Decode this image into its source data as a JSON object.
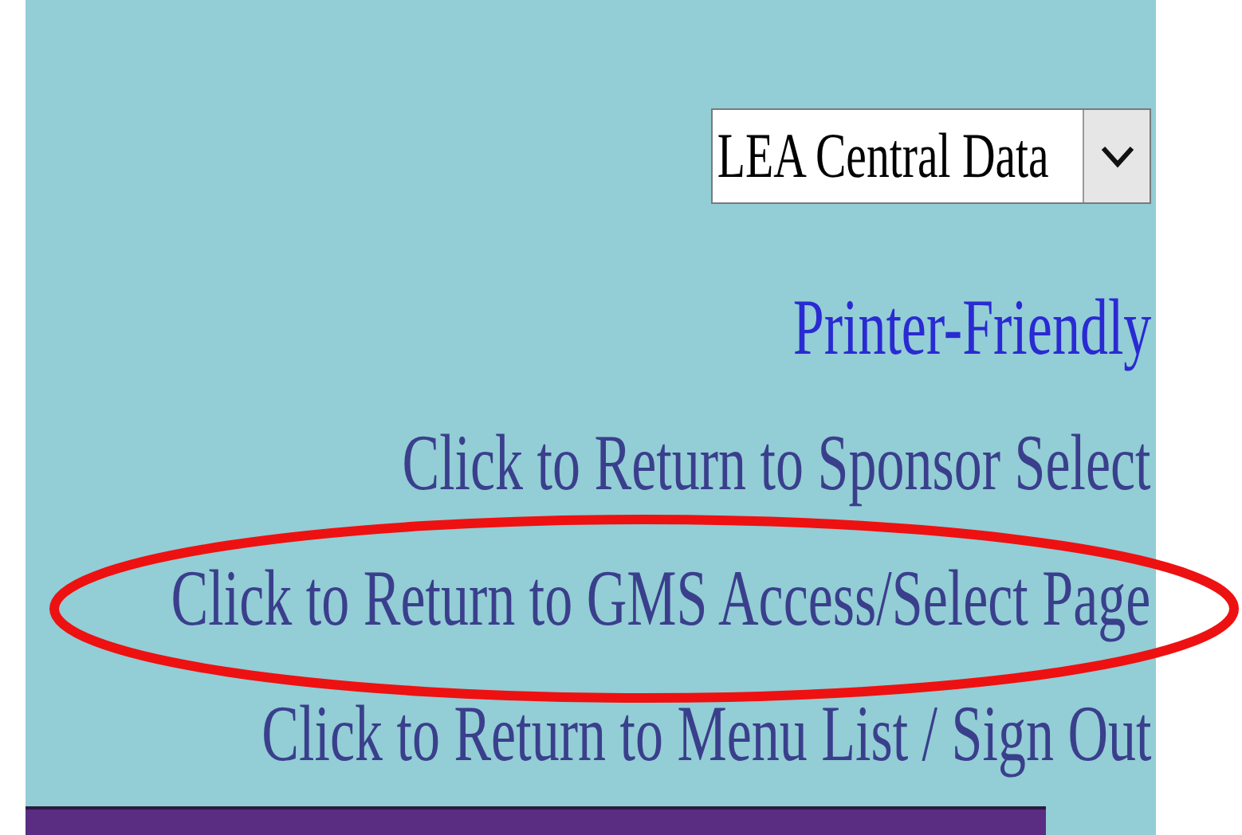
{
  "sponsor_select": {
    "value": "LEA Central Data"
  },
  "links": [
    {
      "label": "Printer-Friendly",
      "kind": "primary"
    },
    {
      "label": "Click to Return to Sponsor Select",
      "kind": "nav"
    },
    {
      "label": "Click to Return to GMS Access/Select Page",
      "kind": "nav"
    },
    {
      "label": "Click to Return to Menu List / Sign Out",
      "kind": "nav"
    }
  ]
}
